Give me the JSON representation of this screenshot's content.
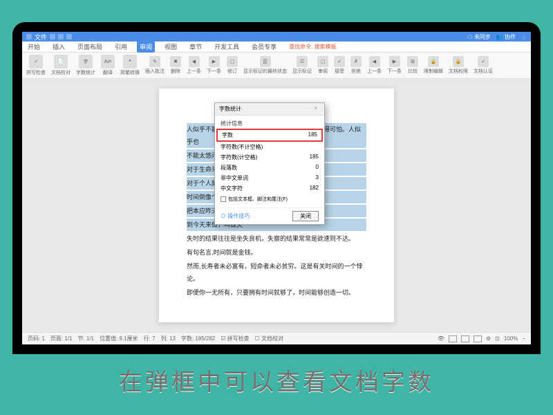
{
  "titlebar": {
    "file_label": "文件",
    "sync_label": "未同步",
    "collab_label": "协作"
  },
  "menu": {
    "items": [
      "开始",
      "插入",
      "页面布局",
      "引用",
      "审阅",
      "视图",
      "章节",
      "开发工具",
      "会员专享"
    ],
    "active_index": 4,
    "search_icon_label": "查找命令",
    "search_placeholder": "搜索模板"
  },
  "toolbar": {
    "groups": [
      {
        "icon": "✓",
        "label": "拼写检查"
      },
      {
        "icon": "📄",
        "label": "文档校对"
      },
      {
        "icon": "字",
        "label": "字数统计"
      },
      {
        "icon": "A⇄",
        "label": "翻译"
      },
      {
        "icon": "❝",
        "label": "简繁转换"
      },
      {
        "icon": "✎",
        "label": "插入批注"
      },
      {
        "icon": "✖",
        "label": "删除"
      },
      {
        "icon": "◀",
        "label": "上一条"
      },
      {
        "icon": "▶",
        "label": "下一条"
      },
      {
        "icon": "▢",
        "label": "修订"
      },
      {
        "icon": "显",
        "label": "显示标记的最终状态"
      },
      {
        "icon": "☰",
        "label": "显示标记"
      },
      {
        "icon": "▢",
        "label": "审阅"
      },
      {
        "icon": "✓",
        "label": "接受"
      },
      {
        "icon": "✗",
        "label": "拒绝"
      },
      {
        "icon": "◀",
        "label": "上一条"
      },
      {
        "icon": "▶",
        "label": "下一条"
      },
      {
        "icon": "⊞",
        "label": "比较"
      },
      {
        "icon": "🔒",
        "label": "限制编辑"
      },
      {
        "icon": "🔒",
        "label": "文档权限"
      },
      {
        "icon": "✓",
        "label": "文档认证"
      }
    ]
  },
  "document": {
    "lines": [
      {
        "text": "人似乎不能太忙碌，太忙碌了，便会觉得时光短暂得可怕。人似乎也",
        "sel": true
      },
      {
        "text": "不能太悠闲，太悠闲                                          无聊。",
        "sel": true
      },
      {
        "text": "对于生命来说，时                                    ，时间是了有情的，",
        "sel": true
      },
      {
        "text": "对于个人的悲喜来说                                  于民族的创伤而言，",
        "sel": true
      },
      {
        "text": "时间倒像个庸医。不                                  择上都有一个最佳点。",
        "sel": true
      },
      {
        "text": "把本应昨天做的事情                                  把应明天做的事情放",
        "sel": true
      },
      {
        "text": "到今天来做，叫做失                                                    ",
        "sel": true
      },
      {
        "text": "失时的结果往往是坐失良机，失察的结果常常是欲速则不达。",
        "sel": false
      },
      {
        "text": "有句名言,时间就是金钱。",
        "sel": false
      },
      {
        "text": "然而,长寿者未必富有，短命者未必贫穷。这是有关时间的一个悖论。",
        "sel": false
      },
      {
        "text": "即便你一无所有，只要拥有时间就够了，时间能够创造一切。",
        "sel": false
      }
    ]
  },
  "dialog": {
    "title": "字数统计",
    "stats_header": "统计信息",
    "rows": [
      {
        "label": "字数",
        "value": "185",
        "highlight": true
      },
      {
        "label": "字符数(不计空格)",
        "value": "",
        "highlight": false
      },
      {
        "label": "字符数(计空格)",
        "value": "185",
        "highlight": false
      },
      {
        "label": "段落数",
        "value": "0",
        "highlight": false
      },
      {
        "label": "非中文单词",
        "value": "3",
        "highlight": false
      },
      {
        "label": "中文字符",
        "value": "182",
        "highlight": false
      }
    ],
    "checkbox_label": "包括文本框、脚注和尾注(F)",
    "tip_label": "⊙ 操作技巧",
    "close_btn": "关闭"
  },
  "statusbar": {
    "page": "页码: 1",
    "page_of": "页面: 1/1",
    "section": "节: 1/1",
    "pos": "位置值: 9.1厘米",
    "line": "行: 7",
    "col": "列: 13",
    "words": "字数: 185/282",
    "spellcheck": "拼写检查",
    "proof": "文档校对",
    "zoom": "100%"
  },
  "caption": "在弹框中可以查看文档字数"
}
